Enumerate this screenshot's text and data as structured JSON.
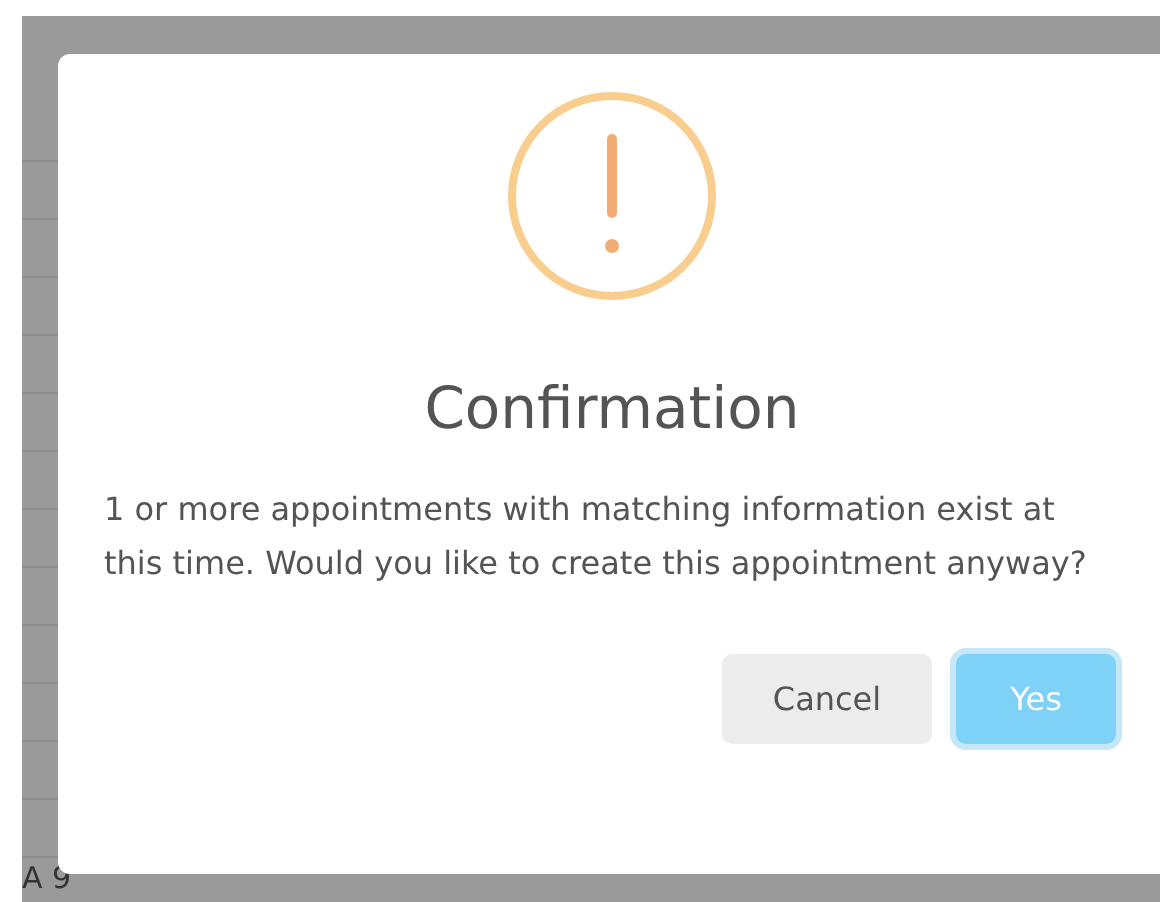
{
  "background": {
    "fragment": "A 9"
  },
  "dialog": {
    "title": "Confirmation",
    "message": "1 or more appointments with matching information exist at this time. Would you like to create this appointment anyway?",
    "buttons": [
      {
        "label": "Cancel",
        "kind": "secondary"
      },
      {
        "label": "Yes",
        "kind": "primary"
      }
    ]
  }
}
